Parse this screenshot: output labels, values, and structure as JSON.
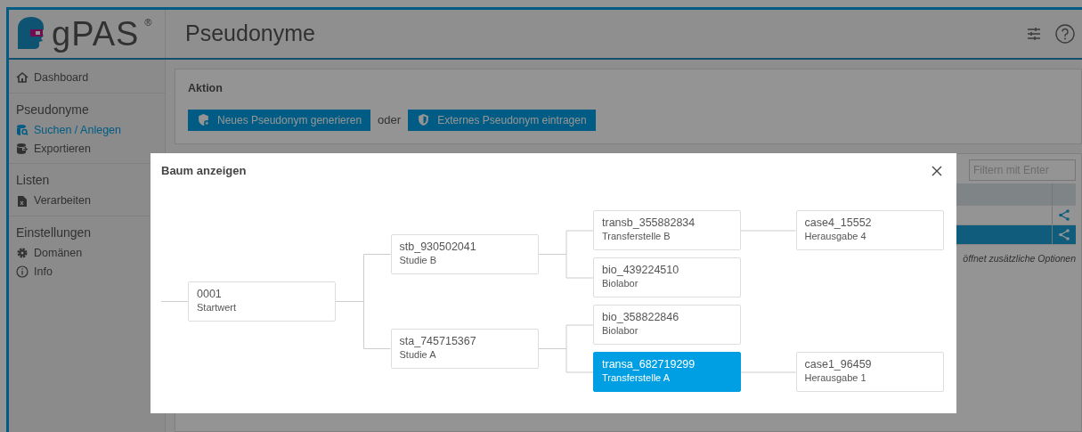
{
  "app": {
    "logo_text": "gPAS",
    "logo_mark": "®",
    "page_title": "Pseudonyme"
  },
  "sidebar": {
    "sections": [
      {
        "items": [
          {
            "label": "Dashboard",
            "selected": false
          }
        ]
      },
      {
        "heading": "Pseudonyme",
        "items": [
          {
            "label": "Suchen / Anlegen",
            "selected": true
          },
          {
            "label": "Exportieren",
            "selected": false
          }
        ]
      },
      {
        "heading": "Listen",
        "items": [
          {
            "label": "Verarbeiten",
            "selected": false
          }
        ]
      },
      {
        "heading": "Einstellungen",
        "items": [
          {
            "label": "Domänen",
            "selected": false
          },
          {
            "label": "Info",
            "selected": false
          }
        ]
      }
    ]
  },
  "action_card": {
    "title": "Aktion",
    "buttons": [
      "Neues Pseudonym generieren",
      "Externes Pseudonym eintragen"
    ],
    "separator": "oder"
  },
  "table": {
    "filter": {
      "placeholder": "Filtern mit Enter"
    },
    "rows": [
      {
        "selected": false
      },
      {
        "selected": true
      }
    ],
    "note": "öffnet zusätzliche Optionen"
  },
  "modal": {
    "title": "Baum anzeigen",
    "tree": {
      "id": "0001",
      "label": "Startwert",
      "selected": false,
      "children": [
        {
          "id": "stb_930502041",
          "label": "Studie B",
          "selected": false,
          "children": [
            {
              "id": "transb_355882834",
              "label": "Transferstelle B",
              "selected": false,
              "children": [
                {
                  "id": "case4_15552",
                  "label": "Herausgabe 4",
                  "selected": false
                }
              ]
            },
            {
              "id": "bio_439224510",
              "label": "Biolabor",
              "selected": false
            }
          ]
        },
        {
          "id": "sta_745715367",
          "label": "Studie A",
          "selected": false,
          "children": [
            {
              "id": "bio_358822846",
              "label": "Biolabor",
              "selected": false
            },
            {
              "id": "transa_682719299",
              "label": "Transferstelle A",
              "selected": true,
              "children": [
                {
                  "id": "case1_96459",
                  "label": "Herausgabe 1",
                  "selected": false
                }
              ]
            }
          ]
        }
      ]
    }
  }
}
